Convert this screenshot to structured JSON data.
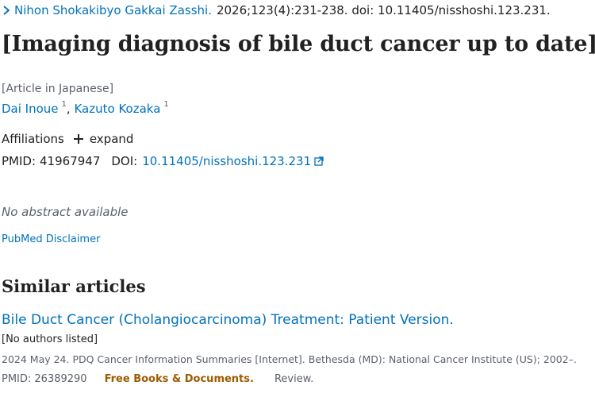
{
  "citation": {
    "journal": "Nihon Shokakibyo Gakkai Zasshi.",
    "details": "2026;123(4):231-238. doi: 10.11405/nisshoshi.123.231."
  },
  "article": {
    "title": "[Imaging diagnosis of bile duct cancer up to date]",
    "language_note": "[Article in Japanese]",
    "authors": [
      {
        "name": "Dai Inoue",
        "affiliation_ref": "1"
      },
      {
        "name": "Kazuto Kozaka",
        "affiliation_ref": "1"
      }
    ],
    "author_separator": ",",
    "affiliations_label": "Affiliations",
    "expand_label": "expand",
    "pmid_label": "PMID:",
    "pmid": "41967947",
    "doi_label": "DOI:",
    "doi": "10.11405/nisshoshi.123.231",
    "abstract_text": "No abstract available",
    "disclaimer_link": "PubMed Disclaimer"
  },
  "similar_articles": {
    "heading": "Similar articles",
    "items": [
      {
        "title": "Bile Duct Cancer (Cholangiocarcinoma) Treatment: Patient Version.",
        "authors": "[No authors listed]",
        "citation": "2024 May 24. PDQ Cancer Information Summaries [Internet]. Bethesda (MD): National Cancer Institute (US); 2002–.",
        "pmid_text": "PMID: 26389290",
        "free_label": "Free Books & Documents.",
        "type_label": "Review."
      }
    ]
  },
  "colors": {
    "link": "#0071bc",
    "text": "#212121",
    "muted": "#5b616b",
    "free_badge": "#9e5b00"
  },
  "icons": {
    "journal_chevron": "chevron-right-icon",
    "expand": "plus-icon",
    "external_link": "external-link-icon"
  }
}
